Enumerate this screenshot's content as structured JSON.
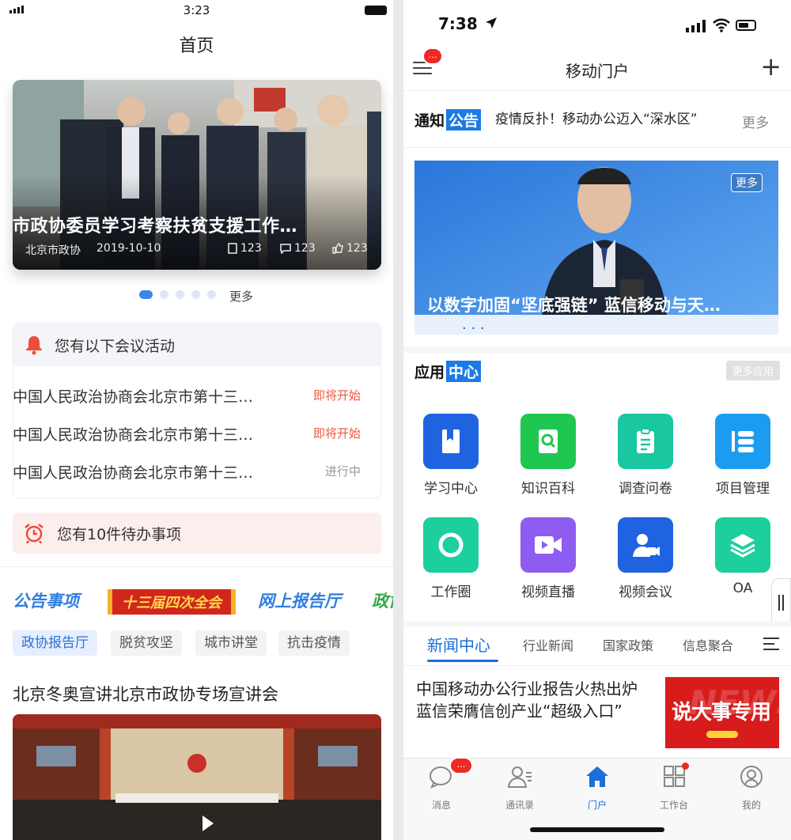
{
  "left": {
    "status": {
      "time": "3:23"
    },
    "page_title": "首页",
    "hero": {
      "title": "市政协委员学习考察扶贫支援工作…",
      "source": "北京市政协",
      "date": "2019-10-10",
      "views": "123",
      "comments": "123",
      "likes": "123"
    },
    "carousel": {
      "count": 5,
      "active": 0,
      "more": "更多"
    },
    "meetings": {
      "header": "您有以下会议活动",
      "items": [
        {
          "title": "中国人民政治协商会北京市第十三…",
          "status": "即将开始",
          "status_color": "#f0553c"
        },
        {
          "title": "中国人民政治协商会北京市第十三…",
          "status": "即将开始",
          "status_color": "#f0553c"
        },
        {
          "title": "中国人民政治协商会北京市第十三…",
          "status": "进行中",
          "status_color": "#999999"
        }
      ]
    },
    "todo": "您有10件待办事项",
    "banners": [
      "公告事项",
      "十三届四次全会",
      "网上报告厅",
      "政协"
    ],
    "chips": [
      "政协报告厅",
      "脱贫攻坚",
      "城市讲堂",
      "抗击疫情"
    ],
    "news_title": "北京冬奥宣讲北京市政协专场宣讲会"
  },
  "right": {
    "status": {
      "time": "7:38"
    },
    "header": {
      "title": "移动门户",
      "menu_badge": "…"
    },
    "notice": {
      "logo_a": "通知",
      "logo_b": "公告",
      "text": "疫情反扑！移动办公迈入“深水区”",
      "more": "更多"
    },
    "hero": {
      "title": "以数字加固“坚底强链” 蓝信移动与天…",
      "more": "更多"
    },
    "app_center": {
      "logo_a": "应用",
      "logo_b": "中心",
      "more": "更多应用",
      "apps": [
        {
          "label": "学习中心",
          "color": "#1f63e0",
          "icon": "book-icon"
        },
        {
          "label": "知识百科",
          "color": "#1fc64f",
          "icon": "search-doc-icon"
        },
        {
          "label": "调查问卷",
          "color": "#19c7a0",
          "icon": "clipboard-icon"
        },
        {
          "label": "项目管理",
          "color": "#1c9cf0",
          "icon": "list-icon"
        },
        {
          "label": "工作圈",
          "color": "#1ccf9d",
          "icon": "circle-icon"
        },
        {
          "label": "视频直播",
          "color": "#8e5cf0",
          "icon": "video-icon"
        },
        {
          "label": "视频会议",
          "color": "#1f63e0",
          "icon": "video-meeting-icon"
        },
        {
          "label": "OA",
          "color": "#1ccf9d",
          "icon": "layers-icon"
        }
      ]
    },
    "news_tabs": [
      "新闻中心",
      "行业新闻",
      "国家政策",
      "信息聚合"
    ],
    "article": {
      "title": "中国移动办公行业报告火热出炉 蓝信荣膺信创产业“超级入口”",
      "thumb_text": "说大事专用",
      "thumb_ghost": "NEWS"
    },
    "tabbar": {
      "items": [
        {
          "label": "消息",
          "icon": "chat-icon",
          "active": false
        },
        {
          "label": "通讯录",
          "icon": "contacts-icon",
          "active": false
        },
        {
          "label": "门户",
          "icon": "home-icon",
          "active": true
        },
        {
          "label": "工作台",
          "icon": "grid-icon",
          "active": false
        },
        {
          "label": "我的",
          "icon": "user-icon",
          "active": false
        }
      ],
      "message_badge": "…"
    },
    "colors": {
      "accent": "#1b6fd8",
      "badge": "#ee2a24"
    }
  }
}
